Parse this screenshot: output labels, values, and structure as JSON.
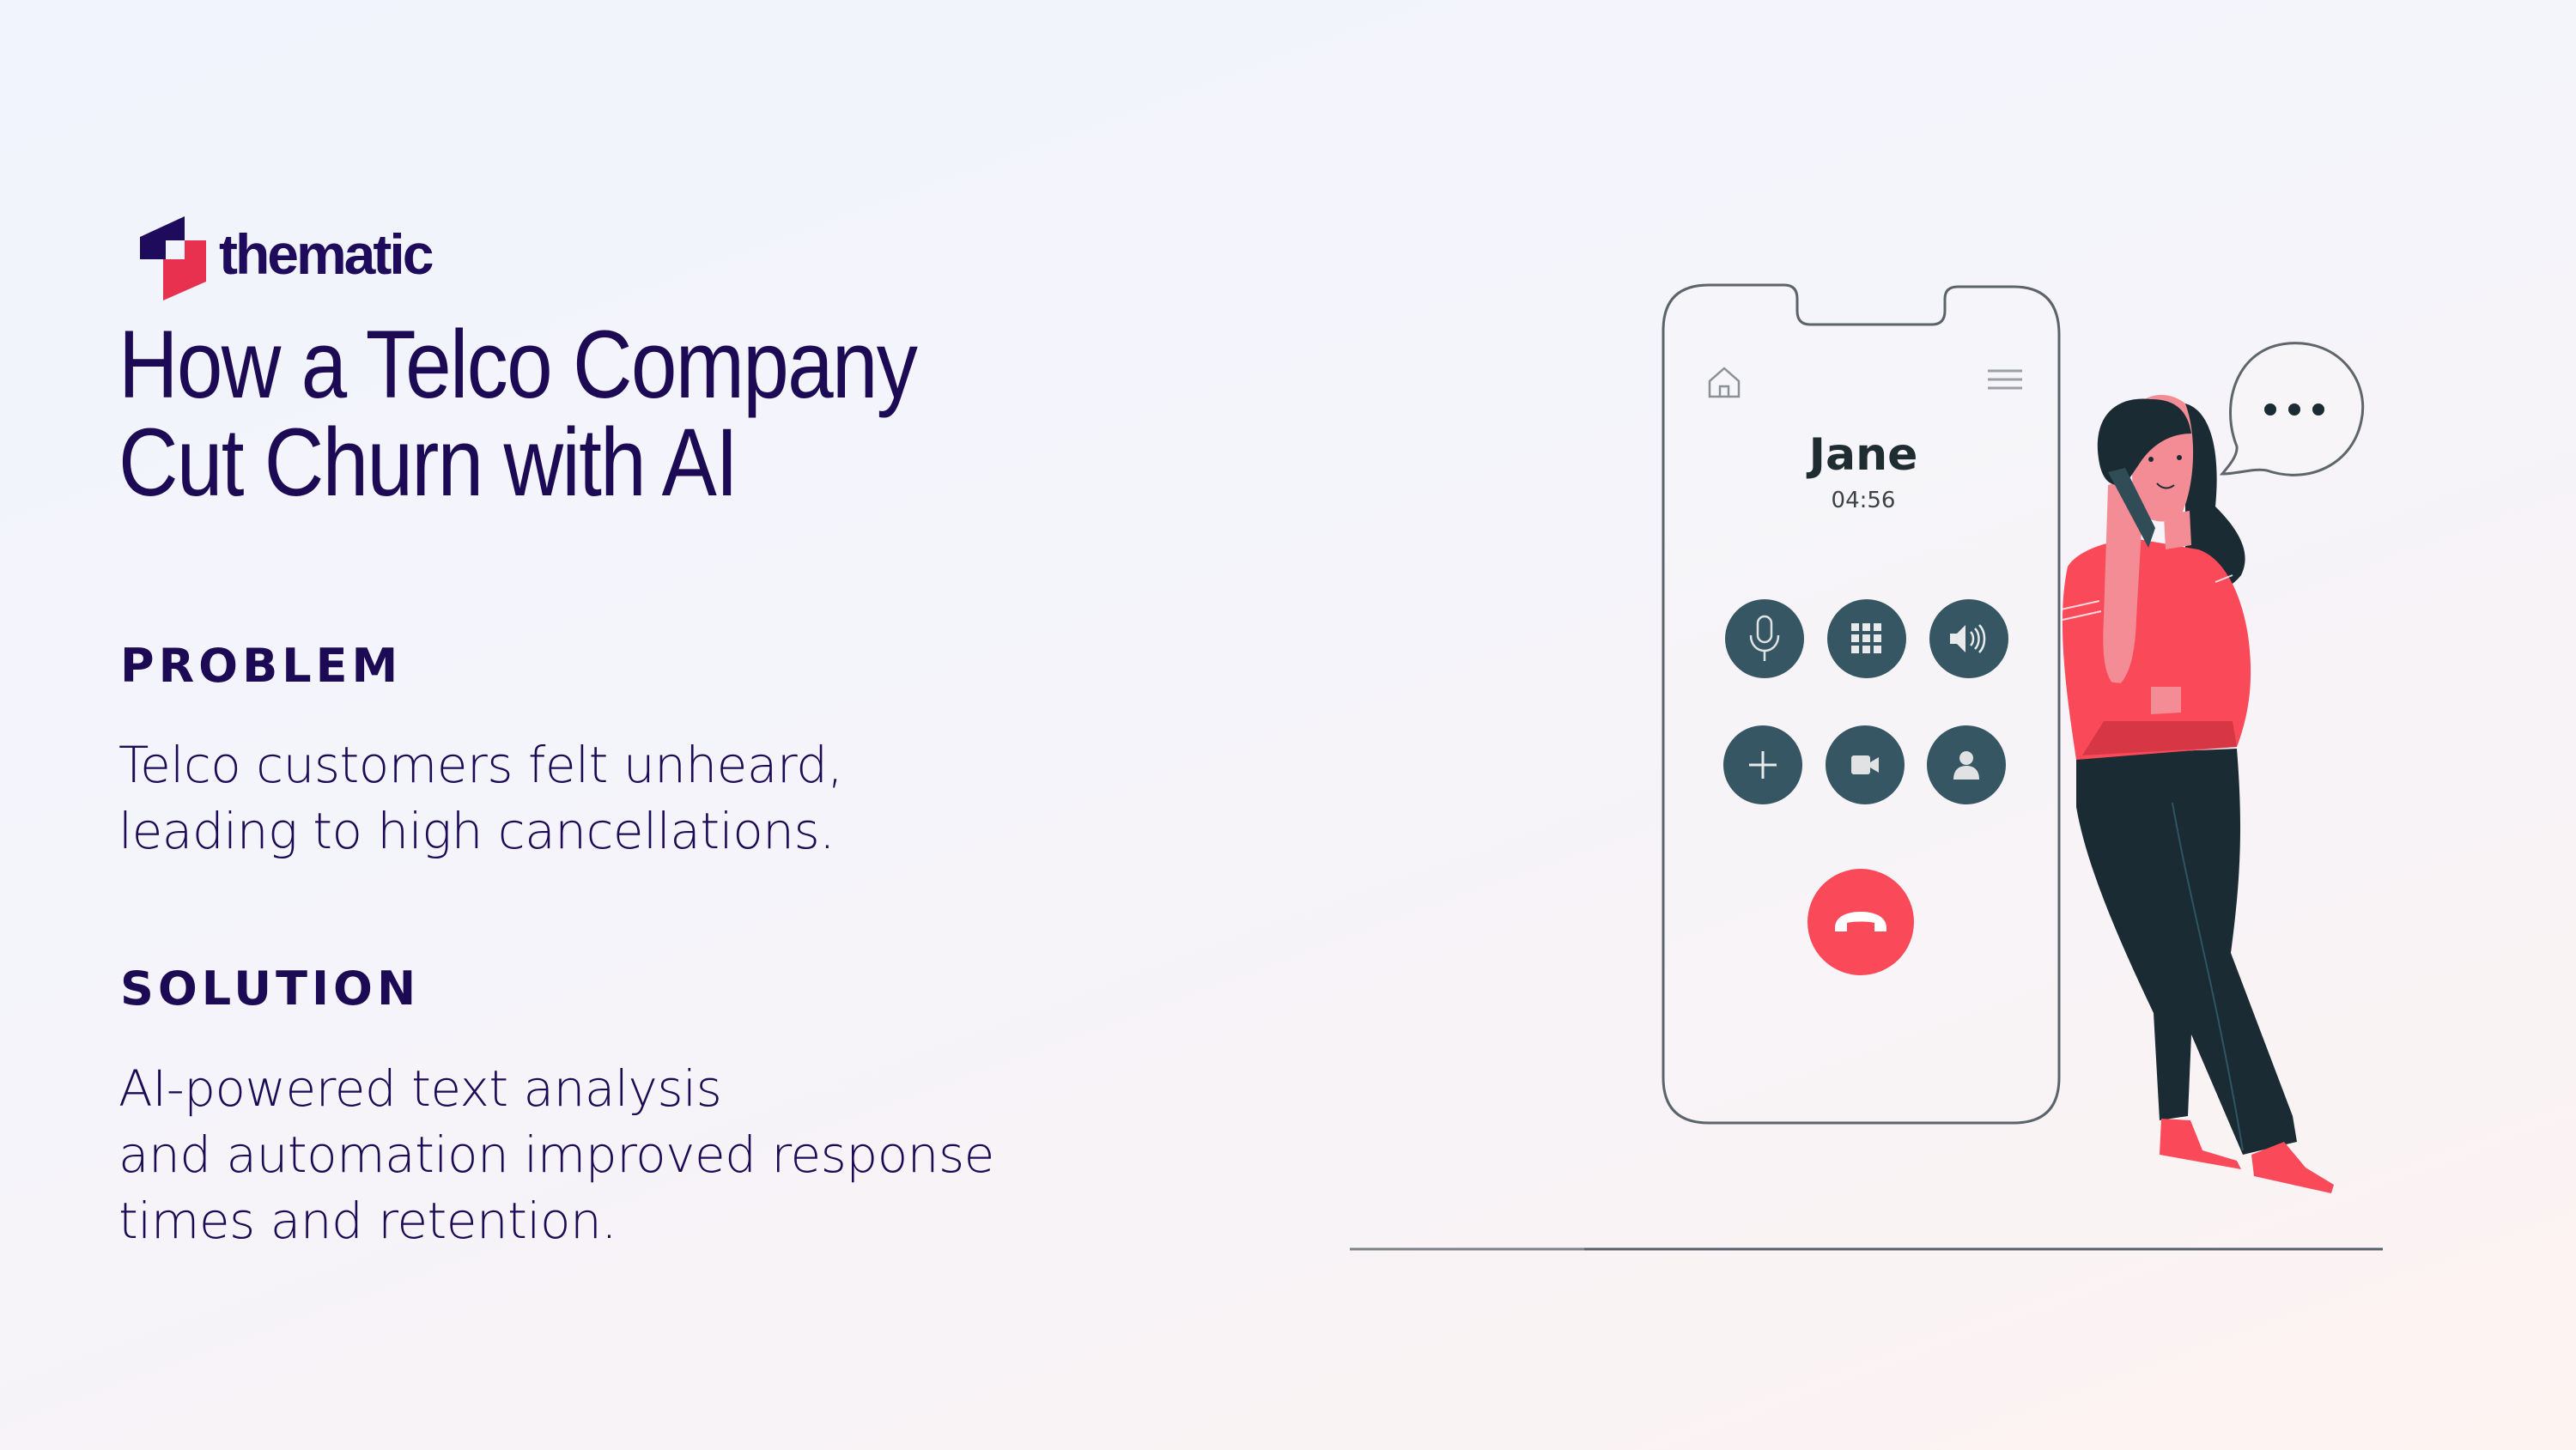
{
  "brand": {
    "name": "thematic",
    "colors": {
      "primary": "#1c0a55",
      "accent": "#e8314f"
    }
  },
  "title": {
    "line1": "How a Telco Company",
    "line2": "Cut Churn with AI"
  },
  "problem": {
    "heading": "PROBLEM",
    "lines": [
      "Telco customers felt unheard,",
      "leading to high cancellations."
    ]
  },
  "solution": {
    "heading": "SOLUTION",
    "lines": [
      "AI-powered text analysis",
      "and automation improved response",
      "times and retention."
    ]
  },
  "illustration": {
    "phone": {
      "caller_name": "Jane",
      "call_duration": "04:56",
      "top_icons": [
        "home-icon",
        "menu-icon"
      ],
      "buttons": [
        "microphone-icon",
        "keypad-icon",
        "speaker-icon",
        "add-call-icon",
        "video-icon",
        "contact-icon"
      ],
      "end_call_icon": "hang-up-icon",
      "colors": {
        "button": "#365664",
        "end_call": "#fa4a5a",
        "outline": "#5b646a"
      }
    },
    "speech_bubble": "ellipsis-icon",
    "person_colors": {
      "shirt": "#fa4a5a",
      "skin": "#f48c96",
      "hair": "#1a2b33",
      "pants": "#1a2b33"
    }
  }
}
